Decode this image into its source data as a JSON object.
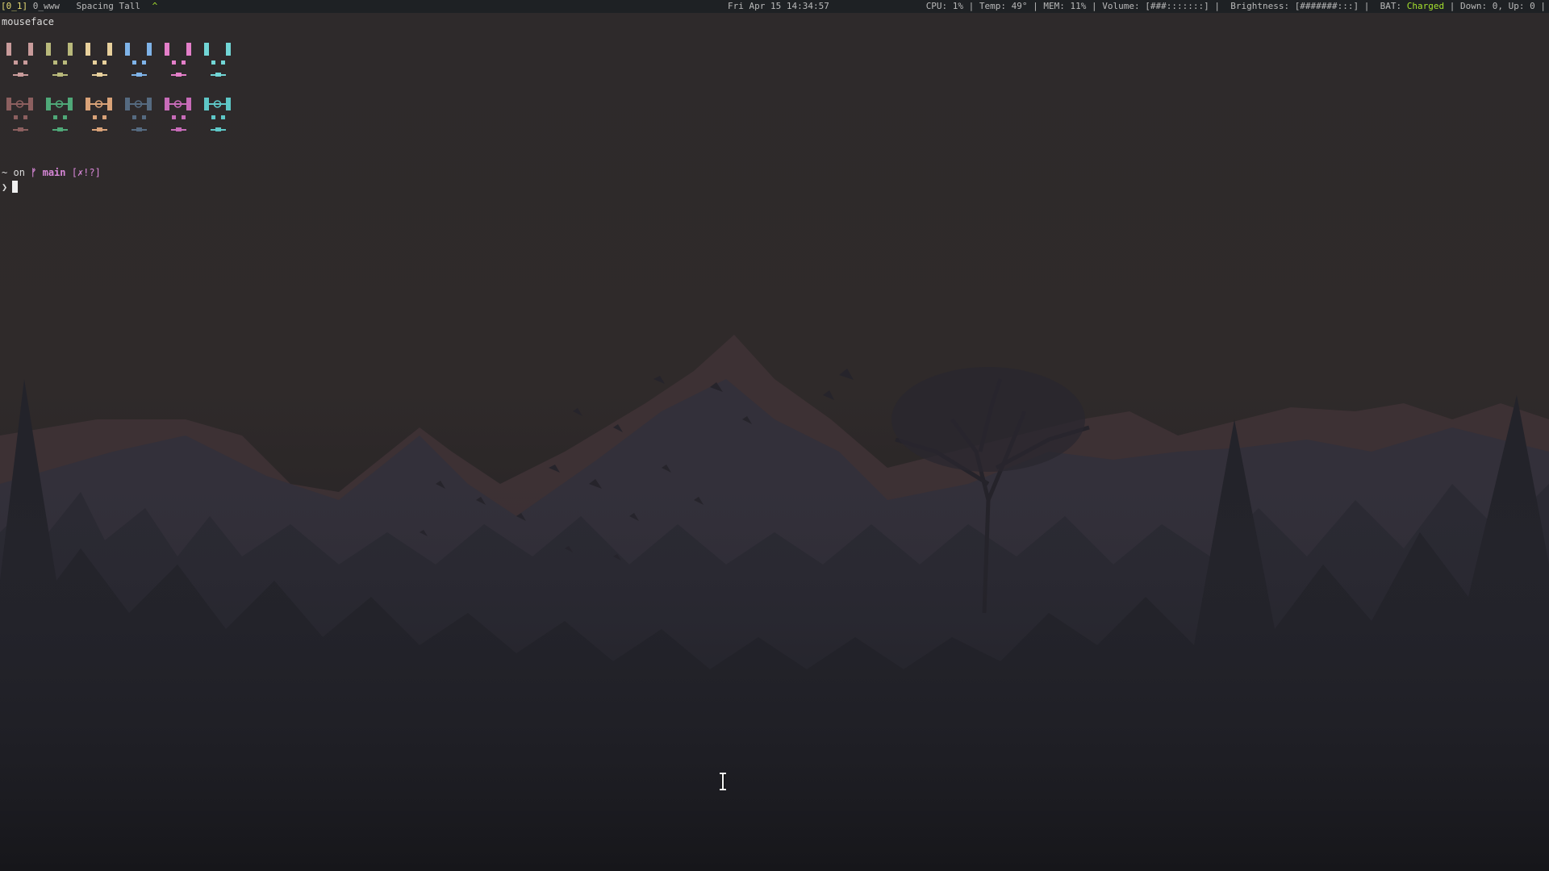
{
  "statusbar": {
    "workspace_current": "[0_1]",
    "workspace_name": "0_www",
    "layout": "Spacing Tall",
    "marker": "^",
    "datetime": "Fri Apr 15 14:34:57",
    "cpu": "CPU: 1%",
    "temp": "Temp: 49°",
    "mem": "MEM: 11%",
    "volume": "Volume: [###:::::::]",
    "brightness": "Brightness: [#######:::]",
    "bat_label": "BAT:",
    "bat_state": "Charged",
    "network": "Down: 0, Up: 0",
    "separator": "|"
  },
  "terminal": {
    "title": "mouseface",
    "prompt_dir": "~",
    "prompt_on": "on",
    "git_branch_symbol": "ᚠ",
    "git_branch": "main",
    "git_status": "[✗!?]",
    "prompt_char": "❯"
  },
  "colors": {
    "normal": [
      "#c99b9b",
      "#b9b97b",
      "#e8d09c",
      "#7fb3e8",
      "#e47fc9",
      "#72d6d6"
    ],
    "bright_row": [
      "#8c5f5f",
      "#4fa878",
      "#d9a278",
      "#556a80",
      "#c76bb8",
      "#5ec7c7"
    ]
  }
}
